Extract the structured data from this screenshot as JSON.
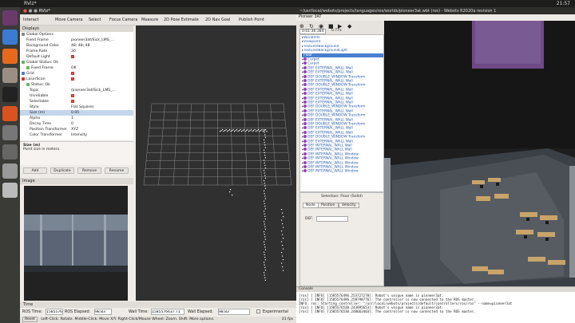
{
  "topbar": {
    "title": "RViz*",
    "clock": "21:57"
  },
  "launcher": {
    "icons": [
      "dash-icon",
      "chrome-icon",
      "firefox-icon",
      "files-icon",
      "terminal-icon",
      "software-icon",
      "settings-icon",
      "trash-icon",
      "rviz-icon",
      "disk-icon"
    ]
  },
  "rviz": {
    "title": "RViz*",
    "toolbar": [
      "Interact",
      "Move Camera",
      "Select",
      "Focus Camera",
      "Measure",
      "2D Pose Estimate",
      "2D Nav Goal",
      "Publish Point"
    ],
    "displays_title": "Displays",
    "rows": [
      {
        "k": "Global Options",
        "v": "",
        "indent": 2,
        "icon": "gear"
      },
      {
        "k": "Fixed Frame",
        "v": "pioneer3at/Sick_LMS_...",
        "indent": 8
      },
      {
        "k": "Background Color",
        "v": "48; 48; 48",
        "indent": 8
      },
      {
        "k": "Frame Rate",
        "v": "30",
        "indent": 8
      },
      {
        "k": "Default Light",
        "v": "",
        "indent": 8,
        "check": true
      },
      {
        "k": "Global Status: Ok",
        "v": "",
        "indent": 2,
        "icon": "ok"
      },
      {
        "k": "Fixed Frame",
        "v": "OK",
        "indent": 8,
        "icon": "ok"
      },
      {
        "k": "Grid",
        "v": "",
        "indent": 2,
        "icon": "grid",
        "check": true
      },
      {
        "k": "LaserScan",
        "v": "",
        "indent": 2,
        "icon": "laser",
        "check": true
      },
      {
        "k": "Status: Ok",
        "v": "",
        "indent": 8,
        "icon": "ok"
      },
      {
        "k": "Topic",
        "v": "/pioneer3at/Sick_LMS_...",
        "indent": 12
      },
      {
        "k": "Unreliable",
        "v": "",
        "indent": 12,
        "check": true
      },
      {
        "k": "Selectable",
        "v": "",
        "indent": 12,
        "check": true
      },
      {
        "k": "Style",
        "v": "Flat Squares",
        "indent": 12
      },
      {
        "k": "Size (m)",
        "v": "0.05",
        "indent": 12,
        "sel": true
      },
      {
        "k": "Alpha",
        "v": "1",
        "indent": 12
      },
      {
        "k": "Decay Time",
        "v": "0",
        "indent": 12
      },
      {
        "k": "Position Transformer",
        "v": "XYZ",
        "indent": 12
      },
      {
        "k": "Color Transformer",
        "v": "Intensity",
        "indent": 12
      }
    ],
    "desc_title": "Size (m)",
    "desc_text": "Point size in meters.",
    "buttons": [
      "Add",
      "Duplicate",
      "Remove",
      "Rename"
    ],
    "image_title": "Image",
    "time_title": "Time",
    "ros_time_label": "ROS Time:",
    "ros_time": "1585576437.68",
    "ros_elapsed_label": "ROS Elapsed:",
    "ros_elapsed": "98.83",
    "wall_time_label": "Wall Time:",
    "wall_time": "1585576437.71",
    "wall_elapsed_label": "Wall Elapsed:",
    "wall_elapsed": "98.83",
    "experimental": "Experimental",
    "reset": "Reset",
    "status": "Left-Click: Rotate. Middle-Click: Move X/Y. Right-Click/Mouse Wheel: Zoom. Shift: More options.",
    "fps": "31 fps"
  },
  "webots": {
    "title": "~/usr/local/webots/projects/languages/ros/worlds/pioneer3at.wbt (ros) - Webots R2020a revision 1",
    "menu": "Pioneer 3AT",
    "sim_time": "0:01:36:384",
    "speed": "0.77x",
    "scene": [
      {
        "t": "WorldInfo",
        "b": false
      },
      {
        "t": "Viewpoint",
        "b": false
      },
      {
        "t": "TexturedBackground",
        "b": false
      },
      {
        "t": "TexturedBackgroundLight",
        "b": false
      },
      {
        "t": "Floor",
        "b": false,
        "sel": true
      },
      {
        "t": "Carpet",
        "b": true
      },
      {
        "t": "Carpet",
        "b": true
      },
      {
        "t": "DEF EXTERNAL_WALL Wall",
        "b": true
      },
      {
        "t": "DEF EXTERNAL_WALL Wall",
        "b": true
      },
      {
        "t": "DEF DOUBLE_WINDOW Transform",
        "b": true
      },
      {
        "t": "DEF EXTERNAL_WALL Wall",
        "b": true
      },
      {
        "t": "DEF DOUBLE_WINDOW Transform",
        "b": true
      },
      {
        "t": "DEF EXTERNAL_WALL Wall",
        "b": true
      },
      {
        "t": "DEF EXTERNAL_WALL Wall",
        "b": true
      },
      {
        "t": "DEF EXTERNAL_WALL Wall",
        "b": true
      },
      {
        "t": "DEF EXTERNAL_WALL Wall",
        "b": true
      },
      {
        "t": "DEF DOUBLE_WINDOW Transform",
        "b": true
      },
      {
        "t": "DEF EXTERNAL_WALL Wall",
        "b": true
      },
      {
        "t": "DEF DOUBLE_WINDOW Transform",
        "b": true
      },
      {
        "t": "DEF EXTERNAL_WALL Wall",
        "b": true
      },
      {
        "t": "DEF DOUBLE_WINDOW Transform",
        "b": true
      },
      {
        "t": "DEF EXTERNAL_WALL Wall",
        "b": true
      },
      {
        "t": "DEF EXTERNAL_WALL Wall",
        "b": true
      },
      {
        "t": "DEF DOUBLE_WINDOW Transform",
        "b": true
      },
      {
        "t": "DEF EXTERNAL_WALL Wall",
        "b": true
      },
      {
        "t": "DEF INTERNAL_WALL Wall",
        "b": true
      },
      {
        "t": "DEF INTERNAL_WALL Wall",
        "b": true
      },
      {
        "t": "DEF INTERNAL_WALL Window",
        "b": true
      },
      {
        "t": "DEF INTERNAL_WALL Window",
        "b": true
      },
      {
        "t": "DEF INTERNAL_WALL Window",
        "b": true
      },
      {
        "t": "DEF INTERNAL_WALL Window",
        "b": true
      },
      {
        "t": "DEF INTERNAL_WALL Window",
        "b": true
      }
    ],
    "selection": "Selection: Floor (Solid)",
    "tabs": [
      "Node",
      "Position",
      "Velocity"
    ],
    "def_label": "DEF:",
    "console_title": "Console",
    "console": [
      "[ros]  [ INFO] [1585576496.253727270]: Robot's unique name is pioneer3at.",
      "[ros]  [ INFO] [1585576496.258798776]: The controller is now connected to the ROS master.",
      "INFO: ros: Starting controller: \"/usr/local/webots/projects/default/controllers/ros/ros\" --name=pioneer3at",
      "[ros]  [ INFO] [1585576530.243895653]: Robot's unique name is pioneer3at.",
      "[ros]  [ INFO] [1585576530.248663403]: The controller is now connected to the ROS master."
    ]
  }
}
